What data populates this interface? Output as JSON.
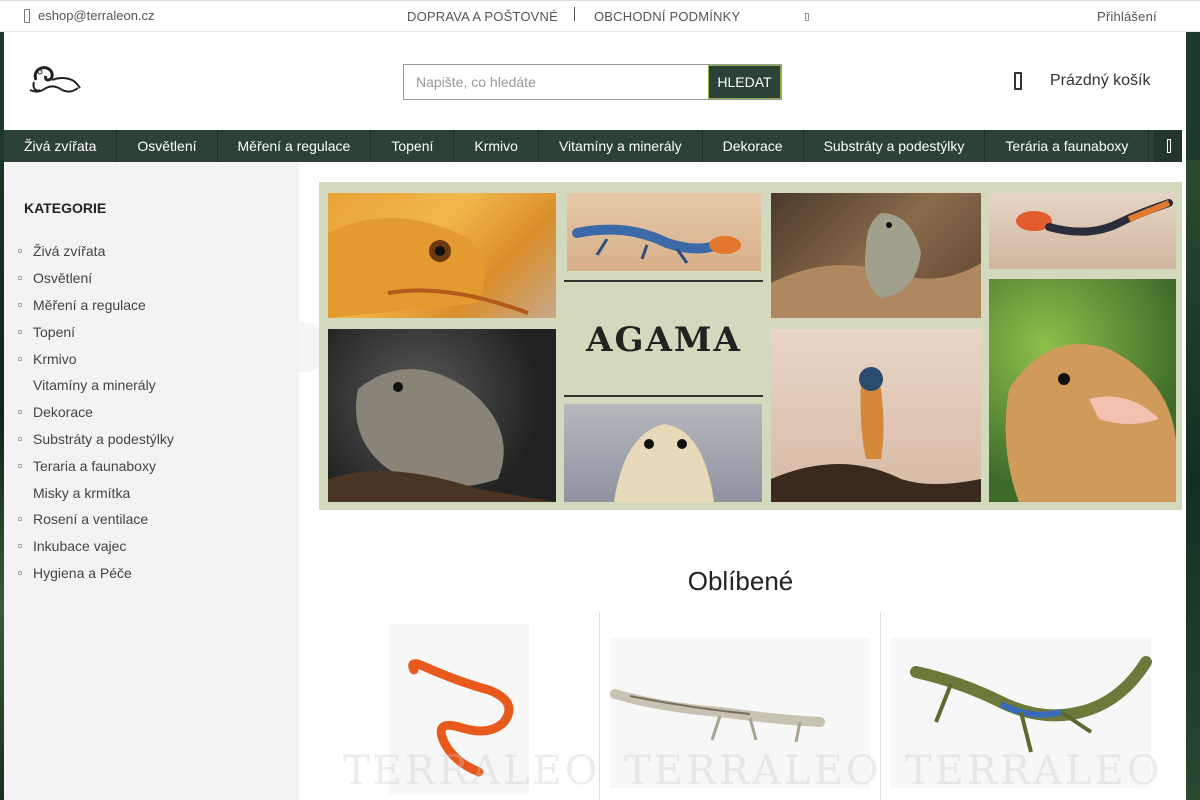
{
  "topbar": {
    "email": "eshop@terraleon.cz",
    "links": [
      "DOPRAVA A POŠTOVNÉ",
      "OBCHODNÍ PODMÍNKY"
    ],
    "login": "Přihlášení"
  },
  "header": {
    "search_placeholder": "Napište, co hledáte",
    "search_button": "HLEDAT",
    "cart_label": "Prázdný košík"
  },
  "nav": {
    "items": [
      "Živá zvířata",
      "Osvětlení",
      "Měření a regulace",
      "Topení",
      "Krmivo",
      "Vitamíny a minerály",
      "Dekorace",
      "Substráty a podestýlky",
      "Terária a faunaboxy"
    ]
  },
  "sidebar": {
    "title": "KATEGORIE",
    "items": [
      {
        "label": "Živá zvířata",
        "bullet": true
      },
      {
        "label": "Osvětlení",
        "bullet": true
      },
      {
        "label": "Měření a regulace",
        "bullet": true
      },
      {
        "label": "Topení",
        "bullet": true
      },
      {
        "label": "Krmivo",
        "bullet": true
      },
      {
        "label": "Vitamíny a minerály",
        "bullet": false
      },
      {
        "label": "Dekorace",
        "bullet": true
      },
      {
        "label": "Substráty a podestýlky",
        "bullet": true
      },
      {
        "label": "Teraria a faunaboxy",
        "bullet": true
      },
      {
        "label": "Misky a krmítka",
        "bullet": false
      },
      {
        "label": "Rosení a ventilace",
        "bullet": true
      },
      {
        "label": "Inkubace vajec",
        "bullet": true
      },
      {
        "label": "Hygiena a Péče",
        "bullet": true
      }
    ]
  },
  "banner": {
    "title": "AGAMA"
  },
  "favorites": {
    "title": "Oblíbené",
    "watermark": "TERRALEON"
  },
  "colors": {
    "nav_bg": "#2d4236",
    "accent": "#8fb04a",
    "banner_bg": "#d3d9bd"
  }
}
